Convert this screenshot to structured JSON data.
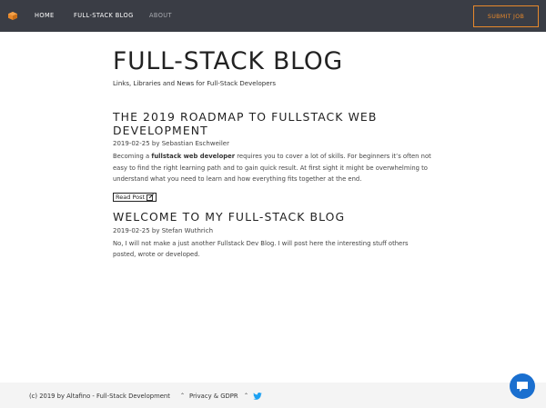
{
  "colors": {
    "topbar": "#3a3d45",
    "accent": "#e8892b",
    "link_blue": "#1a6fcf"
  },
  "nav": {
    "logo_icon": "orange-cube-icon",
    "items": [
      {
        "label": "HOME"
      },
      {
        "label": "FULL-STACK BLOG"
      },
      {
        "label": "ABOUT"
      }
    ],
    "submit_label": "SUBMIT JOB"
  },
  "site": {
    "title": "FULL-STACK BLOG",
    "tagline": "Links, Libraries and News for Full-Stack Developers"
  },
  "posts": [
    {
      "title": "THE 2019 ROADMAP TO FULLSTACK WEB DEVELOPMENT",
      "meta": "2019-02-25 by Sebastian Eschweiler",
      "excerpt_pre": "Becoming a ",
      "excerpt_bold": "fullstack web developer",
      "excerpt_post": " requires you to cover a lot of skills. For beginners it’s often not easy to find the right learning path and to gain quick result. At first sight it might be overwhelming to understand what you need to learn and how everything fits together at the end.",
      "read_more": "Read Post"
    },
    {
      "title": "WELCOME TO MY FULL-STACK BLOG",
      "meta": "2019-02-25 by Stefan Wuthrich",
      "excerpt": "No, I will not make a just another Fullstack Dev Blog. I will post here the interesting stuff others posted, wrote or developed."
    }
  ],
  "footer": {
    "copyright": "(c) 2019 by Altafino - Full-Stack Development",
    "privacy": "Privacy & GDPR",
    "caret_symbol": "⌃",
    "social_icon": "twitter-icon"
  },
  "chat": {
    "icon": "chat-bubble-icon"
  }
}
